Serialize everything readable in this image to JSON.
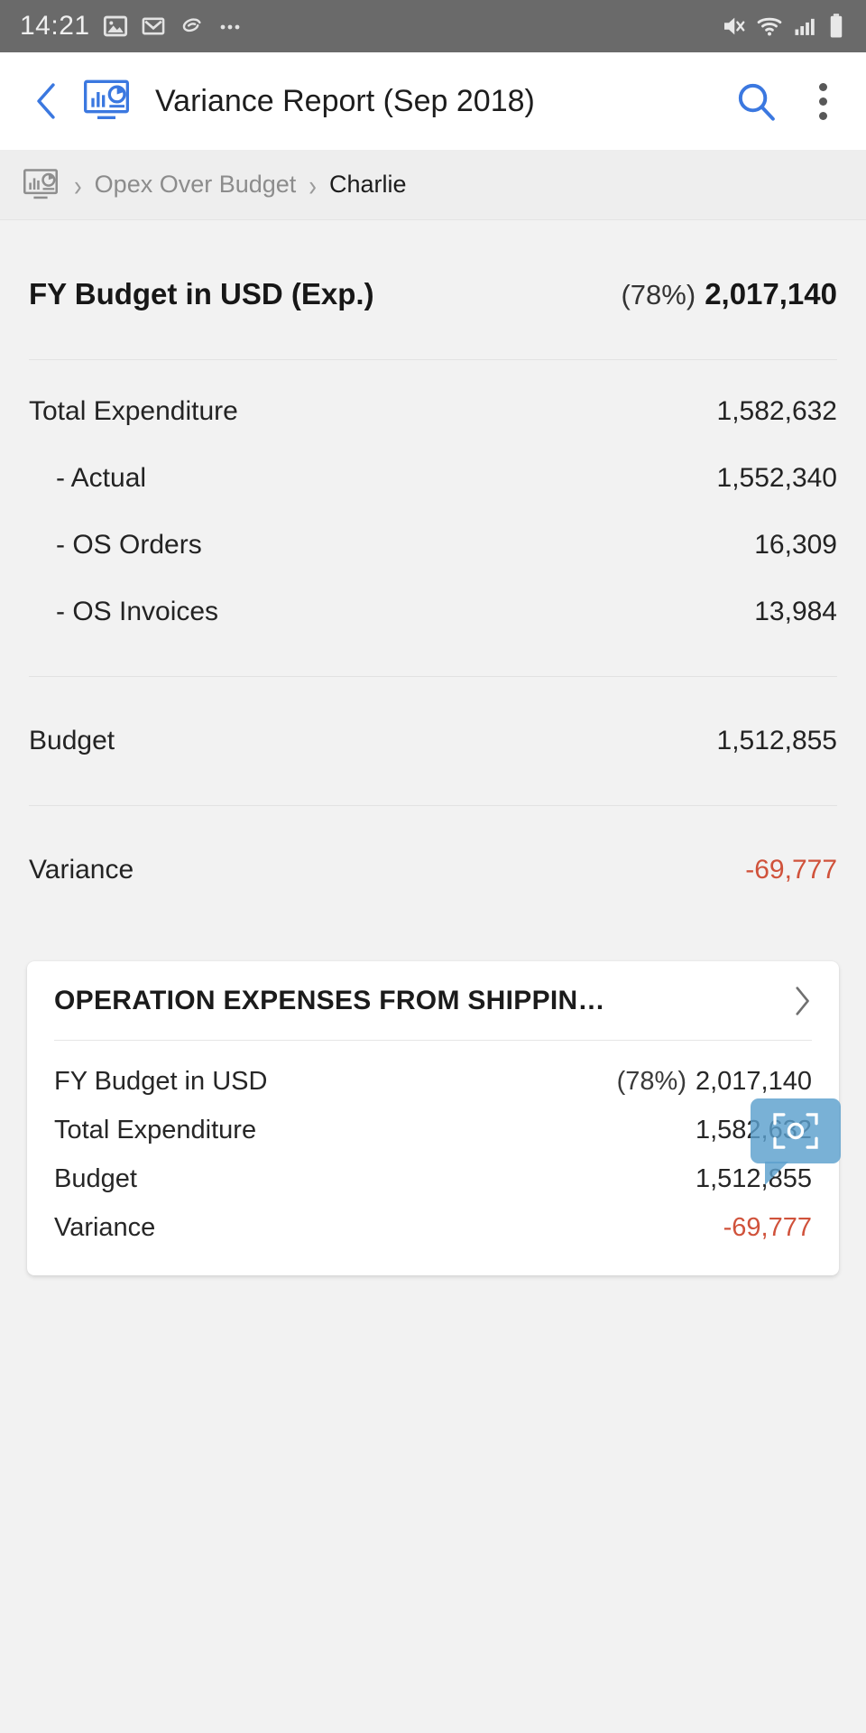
{
  "statusbar": {
    "time": "14:21",
    "left_icons": [
      "photos-icon",
      "gmail-icon",
      "swirl-app-icon",
      "more-notifications-icon"
    ],
    "right_icons": [
      "mute-vibrate-icon",
      "wifi-icon",
      "cellular-signal-icon",
      "battery-icon"
    ],
    "background": "#6a6a6a"
  },
  "appbar": {
    "back_icon": "back-chevron-icon",
    "app_icon": "dashboard-report-icon",
    "title": "Variance Report (Sep 2018)",
    "search_icon": "search-icon",
    "overflow_icon": "overflow-menu-icon",
    "accent": "#3b78e0"
  },
  "breadcrumb": {
    "icon": "dashboard-report-icon",
    "separator": "›",
    "items": [
      {
        "label": "Opex Over Budget",
        "current": false
      },
      {
        "label": "Charlie",
        "current": true
      }
    ]
  },
  "summary": {
    "header": {
      "label": "FY Budget in USD (Exp.)",
      "percent": "(78%)",
      "value": "2,017,140"
    },
    "rows": [
      {
        "label": "Total Expenditure",
        "value": "1,582,632",
        "sub": false,
        "negative": false
      },
      {
        "label": "- Actual",
        "value": "1,552,340",
        "sub": true,
        "negative": false
      },
      {
        "label": "- OS Orders",
        "value": "16,309",
        "sub": true,
        "negative": false
      },
      {
        "label": "- OS Invoices",
        "value": "13,984",
        "sub": true,
        "negative": false
      }
    ],
    "budget": {
      "label": "Budget",
      "value": "1,512,855"
    },
    "variance": {
      "label": "Variance",
      "value": "-69,777"
    }
  },
  "card": {
    "title": "OPERATION EXPENSES FROM SHIPPIN…",
    "chevron_icon": "chevron-right-icon",
    "rows": [
      {
        "label": "FY Budget in USD",
        "percent": "(78%)",
        "value": "2,017,140",
        "negative": false
      },
      {
        "label": "Total Expenditure",
        "percent": "",
        "value": "1,582,632",
        "negative": false
      },
      {
        "label": "Budget",
        "percent": "",
        "value": "1,512,855",
        "negative": false
      },
      {
        "label": "Variance",
        "percent": "",
        "value": "-69,777",
        "negative": true
      }
    ]
  },
  "fab": {
    "icon": "screenshot-capture-icon",
    "color": "#5ca0cd"
  },
  "colors": {
    "negative": "#d0523b",
    "accent_blue": "#3b78e0",
    "page_background": "#f2f2f2",
    "card_background": "#ffffff",
    "statusbar_background": "#6a6a6a"
  }
}
